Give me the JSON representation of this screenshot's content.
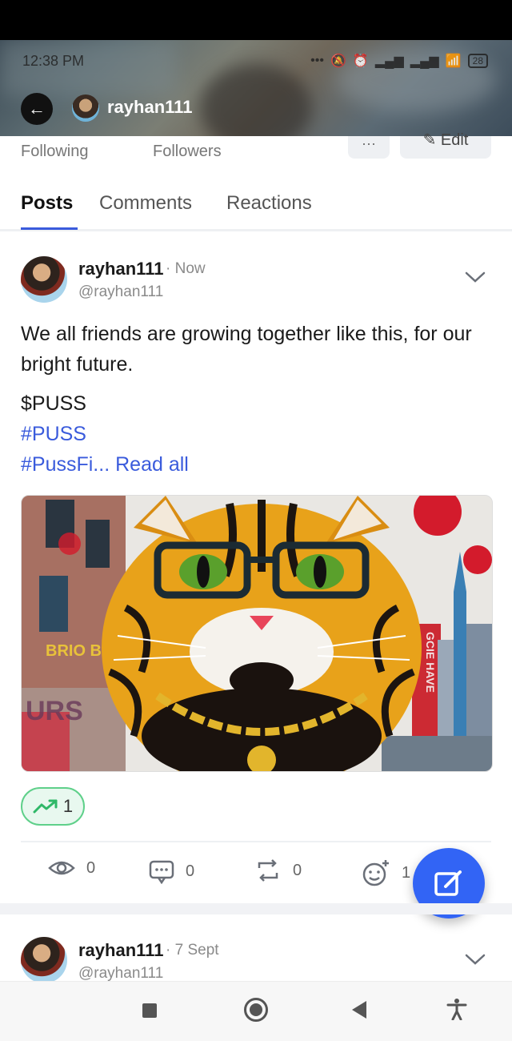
{
  "status_bar": {
    "time": "12:38 PM",
    "battery": "28"
  },
  "header": {
    "username": "rayhan111"
  },
  "profile": {
    "following_label": "Following",
    "followers_label": "Followers",
    "more_label": "···",
    "edit_label": "Edit"
  },
  "tabs": [
    {
      "label": "Posts"
    },
    {
      "label": "Comments"
    },
    {
      "label": "Reactions"
    }
  ],
  "posts": [
    {
      "author": "rayhan111",
      "time": "· Now",
      "handle": "@rayhan111",
      "text": "We all friends are growing together like this, for our bright future.",
      "cashtag": "$PUSS",
      "hashtag1": "#PUSS",
      "hashtag2": "#PussFi...",
      "read_all": "Read all",
      "image_text": [
        "GCIE HAVE",
        "BRIO BIME",
        "URS"
      ],
      "trend_count": "1",
      "views": "0",
      "comments": "0",
      "reposts": "0",
      "reactions": "1"
    },
    {
      "author": "rayhan111",
      "time": "· 7 Sept",
      "handle": "@rayhan111"
    }
  ],
  "colors": {
    "accent": "#3a5bdc",
    "fab": "#3264f5",
    "trend": "#5fd08a"
  }
}
